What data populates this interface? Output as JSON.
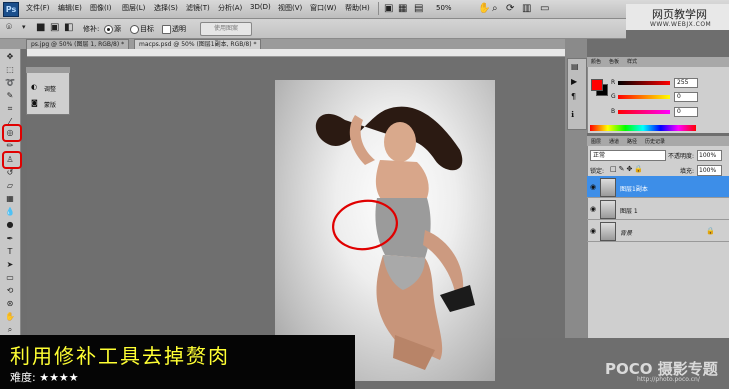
{
  "app": {
    "logo": "Ps"
  },
  "menu": [
    "文件(F)",
    "编辑(E)",
    "图像(I)",
    "图层(L)",
    "选择(S)",
    "滤镜(T)",
    "分析(A)",
    "3D(D)",
    "视图(V)",
    "窗口(W)",
    "帮助(H)"
  ],
  "menubar": {
    "zoom": "50%"
  },
  "brand": {
    "title": "网页教学网",
    "url": "WWW.WEBJX.COM"
  },
  "options": {
    "patch_label": "修补:",
    "source_label": "源",
    "target_label": "目标",
    "transparent_label": "透明",
    "use_pattern": "使用图案"
  },
  "tabs": [
    {
      "label": "ps.jpg @ 50% (图层 1, RGB/8) *"
    },
    {
      "label": "macps.psd @ 50% (图层1副本, RGB/8) *"
    }
  ],
  "adjust_panel": {
    "items": [
      "调整",
      "蒙版"
    ]
  },
  "color_panel": {
    "tabs": [
      "颜色",
      "色板",
      "样式"
    ],
    "r_label": "R",
    "g_label": "G",
    "b_label": "B",
    "r_value": "255",
    "g_value": "0",
    "b_value": "0",
    "foreground": "#ff0000",
    "background": "#000000"
  },
  "layers_panel": {
    "tabs": [
      "图层",
      "通道",
      "路径",
      "历史记录"
    ],
    "blend_mode": "正常",
    "opacity_label": "不透明度:",
    "opacity_value": "100%",
    "lock_label": "锁定:",
    "fill_label": "填充:",
    "fill_value": "100%",
    "layers": [
      {
        "name": "图层1副本",
        "selected": true
      },
      {
        "name": "图层 1",
        "selected": false
      },
      {
        "name": "背景",
        "selected": false
      }
    ]
  },
  "caption": {
    "title": "利用修补工具去掉赘肉",
    "difficulty": "难度: ★★★★"
  },
  "watermark": {
    "brand": "POCO 摄影专题",
    "url": "http://photo.poco.cn/"
  },
  "colors": {
    "highlight": "#e00000",
    "caption_text": "#ffff33",
    "selected_layer": "#3d8ee8"
  }
}
